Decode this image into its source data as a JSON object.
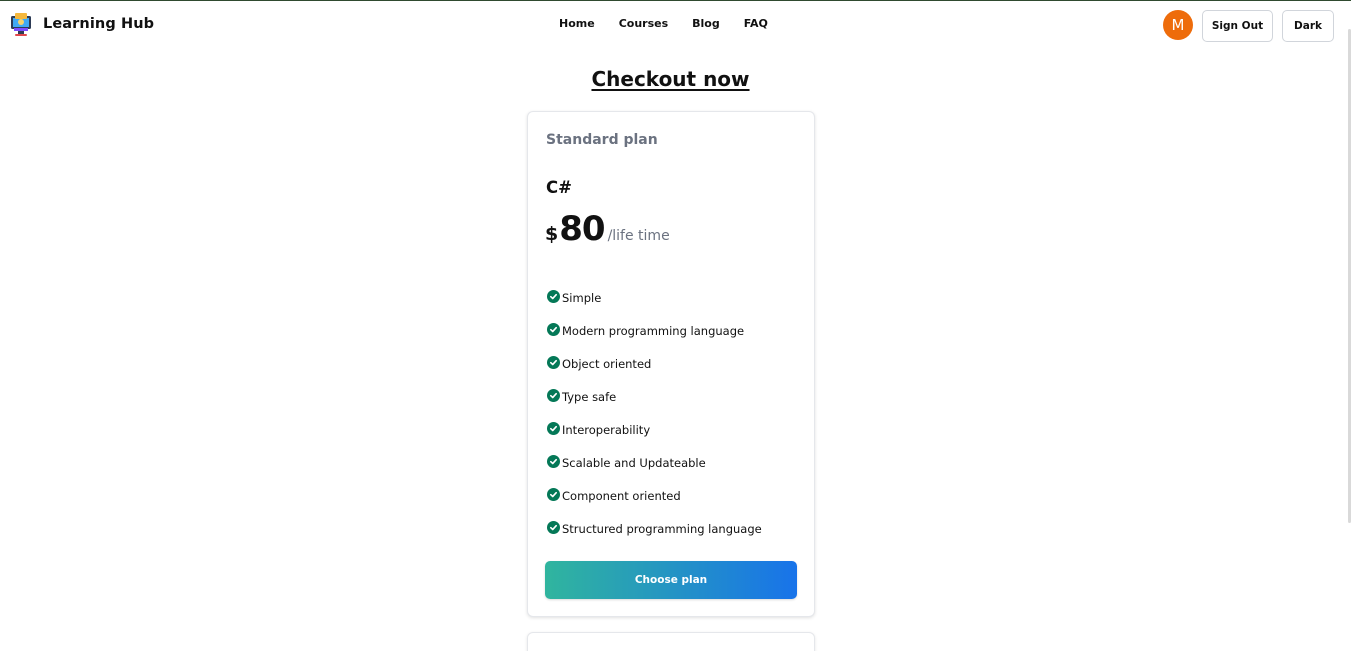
{
  "brand": {
    "name": "Learning Hub",
    "logo_icon": "monitor-logo-icon"
  },
  "nav": {
    "links": [
      "Home",
      "Courses",
      "Blog",
      "FAQ"
    ]
  },
  "user": {
    "avatar_initial": "M",
    "avatar_color": "#ee6c0b"
  },
  "header_buttons": {
    "sign_out": "Sign Out",
    "theme": "Dark"
  },
  "page": {
    "title": "Checkout now"
  },
  "plan": {
    "name": "Standard plan",
    "course": "C#",
    "currency": "$",
    "price": "80",
    "period": "/life time",
    "features": [
      "Simple",
      "Modern programming language",
      "Object oriented",
      "Type safe",
      "Interoperability",
      "Scalable and Updateable",
      "Component oriented",
      "Structured programming language"
    ],
    "feature_icon": "check-circle-icon",
    "check_color": "#047857",
    "button_label": "Choose plan",
    "button_gradient": [
      "#30b59e",
      "#1873ea"
    ]
  }
}
